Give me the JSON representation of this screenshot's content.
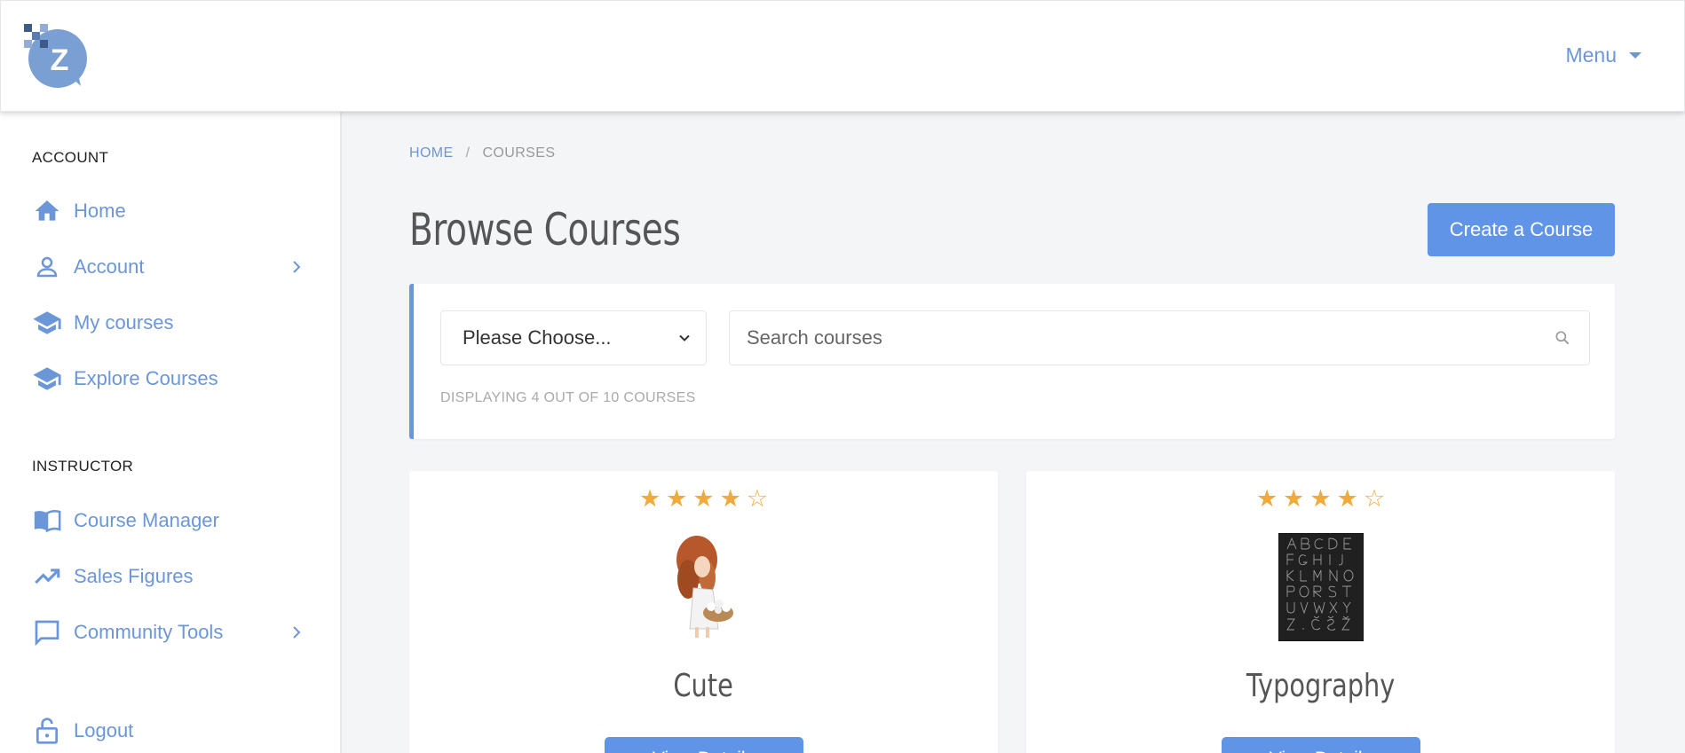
{
  "header": {
    "menu_label": "Menu"
  },
  "sidebar": {
    "account_title": "ACCOUNT",
    "account_items": [
      {
        "label": "Home",
        "icon": "home-icon"
      },
      {
        "label": "Account",
        "icon": "user-icon"
      },
      {
        "label": "My courses",
        "icon": "graduation-cap-icon"
      },
      {
        "label": "Explore Courses",
        "icon": "graduation-cap-icon"
      }
    ],
    "instructor_title": "INSTRUCTOR",
    "instructor_items": [
      {
        "label": "Course Manager",
        "icon": "book-icon"
      },
      {
        "label": "Sales Figures",
        "icon": "trending-up-icon"
      },
      {
        "label": "Community Tools",
        "icon": "chat-icon"
      }
    ],
    "logout_label": "Logout"
  },
  "breadcrumb": {
    "home": "HOME",
    "separator": "/",
    "current": "COURSES"
  },
  "page": {
    "title": "Browse Courses",
    "create_label": "Create a Course"
  },
  "filters": {
    "select_value": "Please Choose...",
    "search_placeholder": "Search courses",
    "display_text": "DISPLAYING 4 OUT OF 10 COURSES"
  },
  "courses": [
    {
      "title": "Cute",
      "rating": 4,
      "max_rating": 5,
      "button_label": "View Details"
    },
    {
      "title": "Typography",
      "rating": 4,
      "max_rating": 5,
      "button_label": "View Details"
    }
  ],
  "colors": {
    "accent": "#6b96d8",
    "button": "#5f94e6",
    "star": "#f0a93b"
  }
}
